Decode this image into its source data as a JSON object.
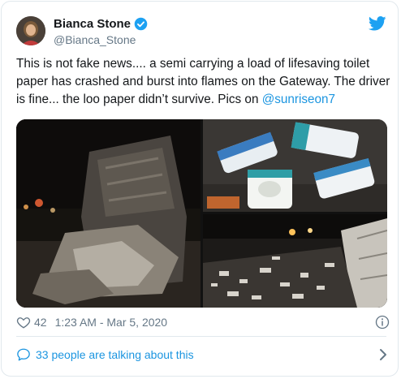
{
  "author": {
    "name": "Bianca Stone",
    "handle": "@Bianca_Stone"
  },
  "tweet": {
    "text_main": "This is not fake news.... a semi carrying a load of lifesaving toilet paper has crashed and burst into flames on the Gateway. The driver is fine... the loo paper didn’t survive. Pics on ",
    "mention": "@sunriseon7"
  },
  "media": {
    "photos": [
      {
        "icon": "burned-truck-night-photo"
      },
      {
        "icon": "toilet-paper-rolls-photo"
      },
      {
        "icon": "debris-on-road-photo"
      }
    ]
  },
  "meta": {
    "likes": "42",
    "timestamp": "1:23 AM - Mar 5, 2020"
  },
  "conversation": {
    "label": "33 people are talking about this"
  },
  "colors": {
    "accent": "#1b95e0",
    "secondary_text": "#657786",
    "border": "#e1e8ed"
  }
}
